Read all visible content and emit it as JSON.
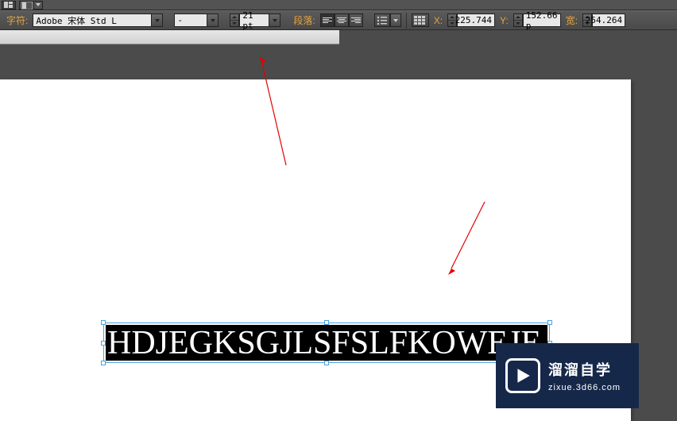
{
  "topbar": {
    "font_label": "字符:",
    "font_family": "Adobe 宋体 Std L",
    "font_style": "-",
    "font_size": "21 pt",
    "para_label": "段落:",
    "x_label": "X:",
    "x_value": "225.744 ",
    "y_label": "Y:",
    "y_value": "152.66 p",
    "w_label": "宽:",
    "w_value": "254.264"
  },
  "document": {
    "text_content": "HDJEGKSGJLSFSLFKOWEJE"
  },
  "watermark": {
    "line1": "溜溜自学",
    "line2": "zixue.3d66.com"
  }
}
